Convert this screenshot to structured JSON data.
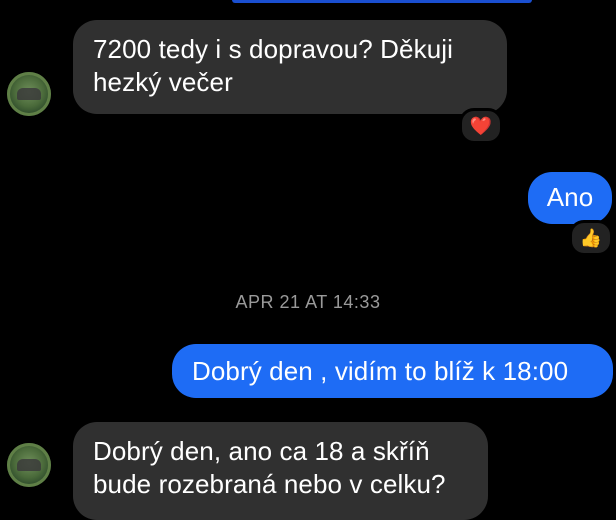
{
  "colors": {
    "background": "#000000",
    "incoming_bubble": "#303030",
    "outgoing_bubble": "#1e6cf5",
    "timestamp_text": "#9a9a9a"
  },
  "messages": [
    {
      "direction": "incoming",
      "lines": [
        "7200 tedy i s dopravou? Děkuji",
        "hezký večer"
      ],
      "reaction": "❤️"
    },
    {
      "direction": "outgoing",
      "text": "Ano",
      "reaction": "👍"
    },
    {
      "direction": "outgoing",
      "text": "Dobrý den , vidím to blíž k 18:00"
    },
    {
      "direction": "incoming",
      "lines": [
        "Dobrý den, ano ca 18 a skříň",
        "bude rozebraná nebo v celku?"
      ]
    }
  ],
  "timestamp": "APR 21 AT 14:33",
  "icons": {
    "avatar": "contact-avatar",
    "heart": "heart-reaction-icon",
    "thumbs_up": "thumbs-up-reaction-icon"
  }
}
